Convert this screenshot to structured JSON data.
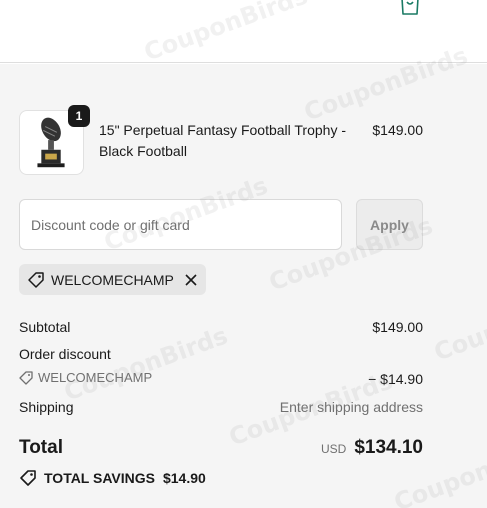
{
  "header": {
    "bag_icon": "shopping-bag-icon"
  },
  "line_item": {
    "quantity": "1",
    "name": "15\" Perpetual Fantasy Football Trophy - Black Football",
    "price": "$149.00",
    "image_icon": "trophy-image"
  },
  "discount": {
    "placeholder": "Discount code or gift card",
    "value": "",
    "apply_label": "Apply",
    "applied_code": "WELCOMECHAMP",
    "tag_icon": "tag-icon",
    "remove_icon": "close-icon"
  },
  "totals": {
    "subtotal_label": "Subtotal",
    "subtotal_value": "$149.00",
    "order_discount_label": "Order discount",
    "discount_code": "WELCOMECHAMP",
    "discount_value": "− $14.90",
    "shipping_label": "Shipping",
    "shipping_value": "Enter shipping address",
    "total_label": "Total",
    "currency": "USD",
    "total_value": "$134.10",
    "savings_label": "TOTAL SAVINGS",
    "savings_value": "$14.90"
  },
  "watermark": "CouponBirds",
  "colors": {
    "accent_dark": "#1a1a1a",
    "background_summary": "#f5f5f5",
    "muted_text": "#707070"
  }
}
